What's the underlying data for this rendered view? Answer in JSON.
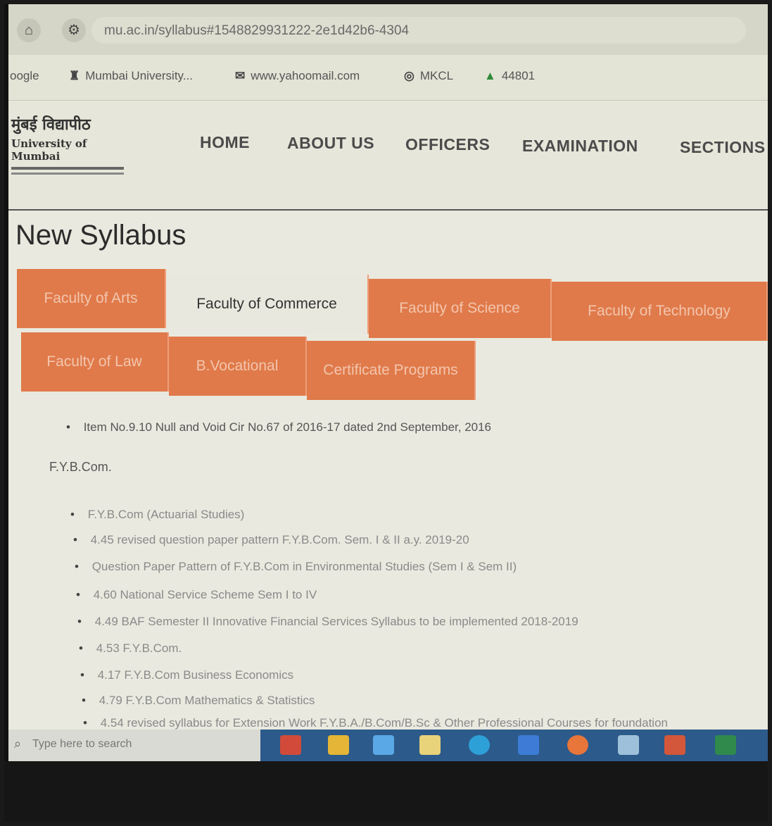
{
  "browser": {
    "url": "mu.ac.in/syllabus#1548829931222-2e1d42b6-4304",
    "bookmarks": [
      {
        "icon": "google-icon",
        "label": "oogle"
      },
      {
        "icon": "bank-icon",
        "label": "Mumbai University..."
      },
      {
        "icon": "mail-icon",
        "label": "www.yahoomail.com"
      },
      {
        "icon": "globe-icon",
        "label": "MKCL"
      },
      {
        "icon": "drive-icon",
        "label": "44801"
      }
    ]
  },
  "site": {
    "logo_line1": "मुंबई विद्यापीठ",
    "logo_line2": "University of Mumbai",
    "nav": [
      "HOME",
      "ABOUT US",
      "OFFICERS",
      "EXAMINATION",
      "SECTIONS"
    ]
  },
  "page": {
    "title": "New Syllabus",
    "tabs_row1": [
      {
        "label": "Faculty of Arts",
        "active": false
      },
      {
        "label": "Faculty of Commerce",
        "active": true
      },
      {
        "label": "Faculty of Science",
        "active": false
      },
      {
        "label": "Faculty of Technology",
        "active": false
      }
    ],
    "tabs_row2": [
      {
        "label": "Faculty of Law"
      },
      {
        "label": "B.Vocational"
      },
      {
        "label": "Certificate Programs"
      }
    ],
    "top_item": "Item No.9.10 Null and Void Cir No.67 of 2016-17 dated 2nd September, 2016",
    "section_heading": "F.Y.B.Com.",
    "items": [
      "F.Y.B.Com (Actuarial Studies)",
      "4.45 revised question paper pattern F.Y.B.Com. Sem. I & II a.y. 2019-20",
      "Question Paper Pattern of F.Y.B.Com in Environmental Studies (Sem I & Sem II)",
      "4.60 National Service Scheme Sem I to IV",
      "4.49 BAF Semester II Innovative Financial Services Syllabus to be implemented 2018-2019",
      "4.53 F.Y.B.Com.",
      "4.17 F.Y.B.Com Business Economics",
      "4.79 F.Y.B.Com Mathematics & Statistics",
      "4.54 revised syllabus for Extension Work F.Y.B.A./B.Com/B.Sc & Other Professional Courses for foundation"
    ]
  },
  "taskbar": {
    "search_placeholder": "Type here to search"
  },
  "colors": {
    "tab_orange": "#e07a4a",
    "taskbar_blue": "#2c5a8a"
  }
}
